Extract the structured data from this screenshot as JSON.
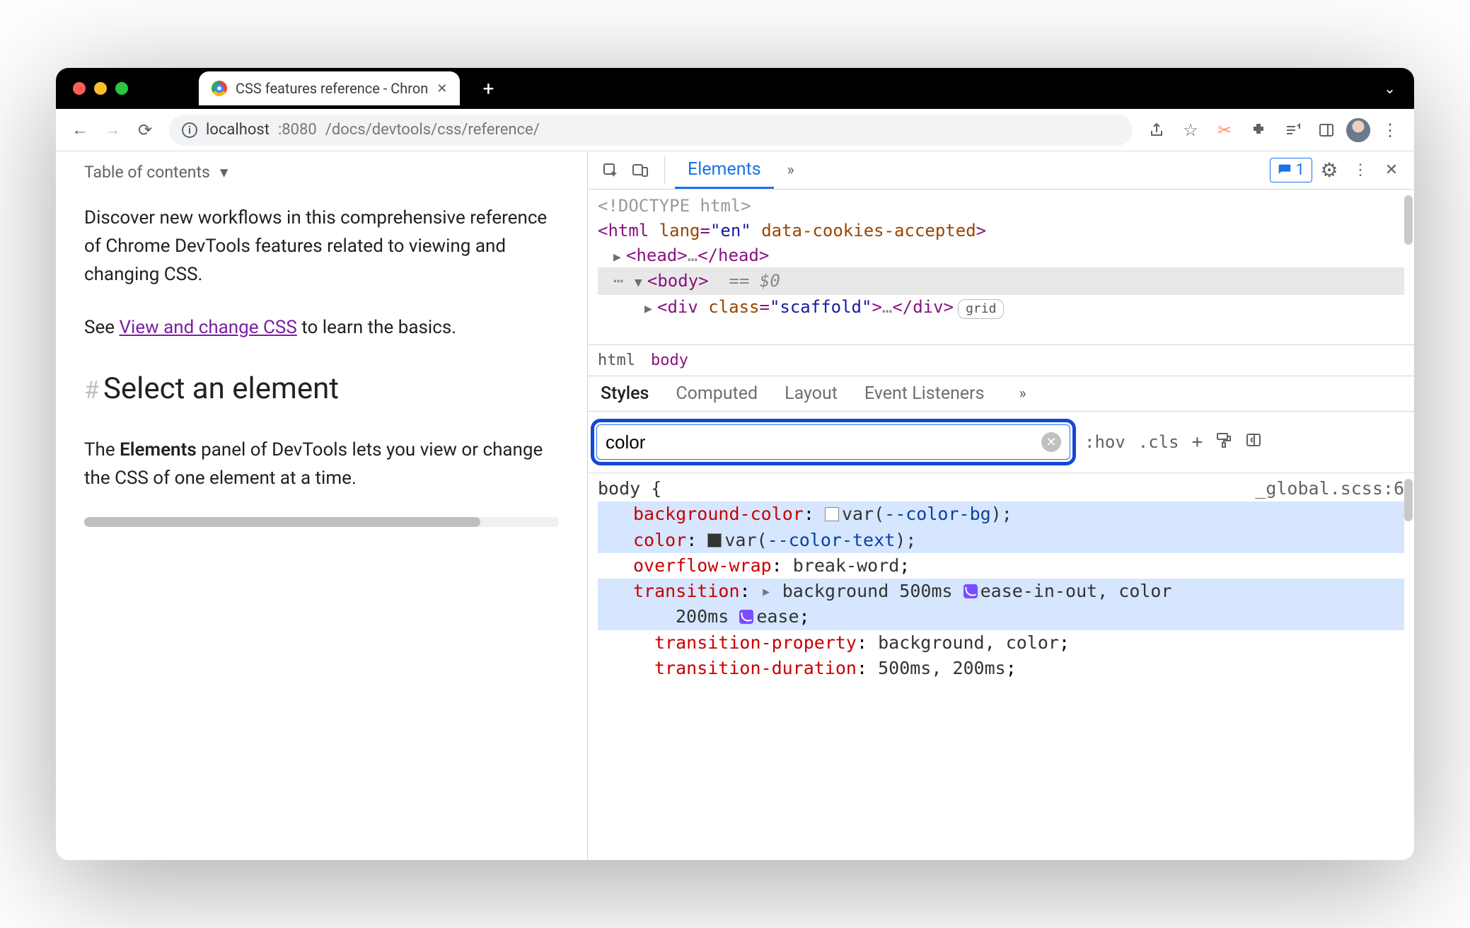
{
  "browser": {
    "tab_title": "CSS features reference - Chron",
    "url_host": "localhost",
    "url_port": ":8080",
    "url_path": "/docs/devtools/css/reference/"
  },
  "page": {
    "toc": "Table of contents",
    "p1": "Discover new workflows in this comprehensive reference of Chrome DevTools features related to viewing and changing CSS.",
    "p2_a": "See ",
    "p2_link": "View and change CSS",
    "p2_b": " to learn the basics.",
    "h2": "Select an element",
    "p3_a": "The ",
    "p3_b": "Elements",
    "p3_c": " panel of DevTools lets you view or change the CSS of one element at a time."
  },
  "devtools": {
    "tabs": {
      "elements": "Elements"
    },
    "issues_count": "1",
    "dom": {
      "doctype": "<!DOCTYPE html>",
      "html_open": "<html ",
      "lang_attr": "lang",
      "lang_val": "\"en\"",
      "cookies_attr": "data-cookies-accepted",
      "head": "<head>",
      "head_dots": "…",
      "head_close": "</head>",
      "body_open": "<body>",
      "body_sel": "== $0",
      "div_open": "<div ",
      "class_attr": "class",
      "class_val": "\"scaffold\"",
      "div_dots": "…",
      "div_close": "</div>",
      "grid_badge": "grid",
      "dots": "⋯"
    },
    "crumbs": {
      "html": "html",
      "body": "body"
    },
    "styles_tabs": {
      "styles": "Styles",
      "computed": "Computed",
      "layout": "Layout",
      "listeners": "Event Listeners"
    },
    "filter": {
      "value": "color",
      "hov": ":hov",
      "cls": ".cls"
    },
    "rule": {
      "selector": "body {",
      "source": "_global.scss:6",
      "p_bgcolor": "background-color",
      "v_bgcolor_var": "--color-bg",
      "p_color": "color",
      "v_color_var": "--color-text",
      "p_overflow": "overflow-wrap",
      "v_overflow": "break-word",
      "p_transition": "transition",
      "v_transition_a": "background 500ms ",
      "v_transition_b": "ease-in-out, color",
      "v_transition_c": "200ms ",
      "v_transition_d": "ease",
      "p_tprop": "transition-property",
      "v_tprop": "background, color",
      "p_tdur": "transition-duration",
      "v_tdur": "500ms, 200ms"
    }
  }
}
